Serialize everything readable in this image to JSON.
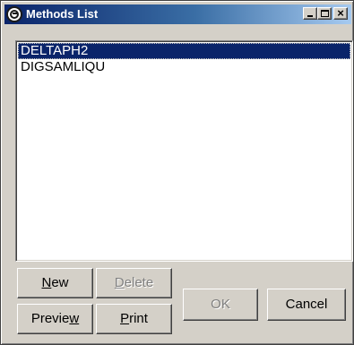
{
  "window": {
    "title": "Methods List"
  },
  "methods": [
    "DELTAPH2",
    "DIGSAMLIQU"
  ],
  "buttons": {
    "new": {
      "pre": "",
      "key": "N",
      "post": "ew"
    },
    "delete": {
      "pre": "",
      "key": "D",
      "post": "elete"
    },
    "preview": {
      "pre": "Previe",
      "key": "w",
      "post": ""
    },
    "print": {
      "pre": "",
      "key": "P",
      "post": "rint"
    },
    "ok": "OK",
    "cancel": "Cancel"
  },
  "colors": {
    "selection": "#0a246a",
    "face": "#d4d0c8",
    "title_start": "#0a246a",
    "title_end": "#a6caf0"
  },
  "icons": {
    "app": "circle-logo-icon",
    "minimize": "minimize-icon",
    "maximize": "maximize-icon",
    "close": "close-icon"
  }
}
